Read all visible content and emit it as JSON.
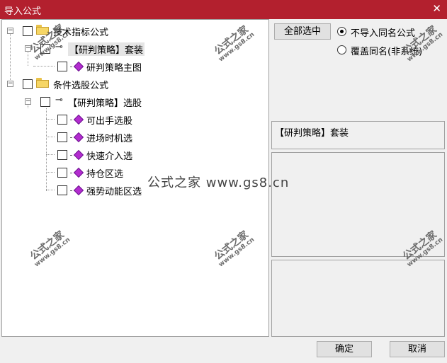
{
  "window": {
    "title": "导入公式",
    "close_glyph": "✕"
  },
  "tree": {
    "items": [
      {
        "label": "技术指标公式",
        "kind": "folder"
      },
      {
        "label": "【研判策略】套装",
        "kind": "key"
      },
      {
        "label": "研判策略主图",
        "kind": "gem"
      },
      {
        "label": "条件选股公式",
        "kind": "folder"
      },
      {
        "label": "【研判策略】选股",
        "kind": "key"
      },
      {
        "label": "可出手选股",
        "kind": "gem"
      },
      {
        "label": "进场时机选",
        "kind": "gem"
      },
      {
        "label": "快速介入选",
        "kind": "gem"
      },
      {
        "label": "持仓区选",
        "kind": "gem"
      },
      {
        "label": "强势动能区选",
        "kind": "gem"
      }
    ]
  },
  "options": {
    "select_all_label": "全部选中",
    "radio_skip_label": "不导入同名公式",
    "radio_overwrite_label": "覆盖同名(非系统)",
    "selected": "skip"
  },
  "info_panel": {
    "text": "【研判策略】套装"
  },
  "footer": {
    "ok_label": "确定",
    "cancel_label": "取消"
  },
  "watermark": {
    "line1": "公式之家",
    "line2": "www.gs8.cn",
    "center": "公式之家 www.gs8.cn"
  }
}
